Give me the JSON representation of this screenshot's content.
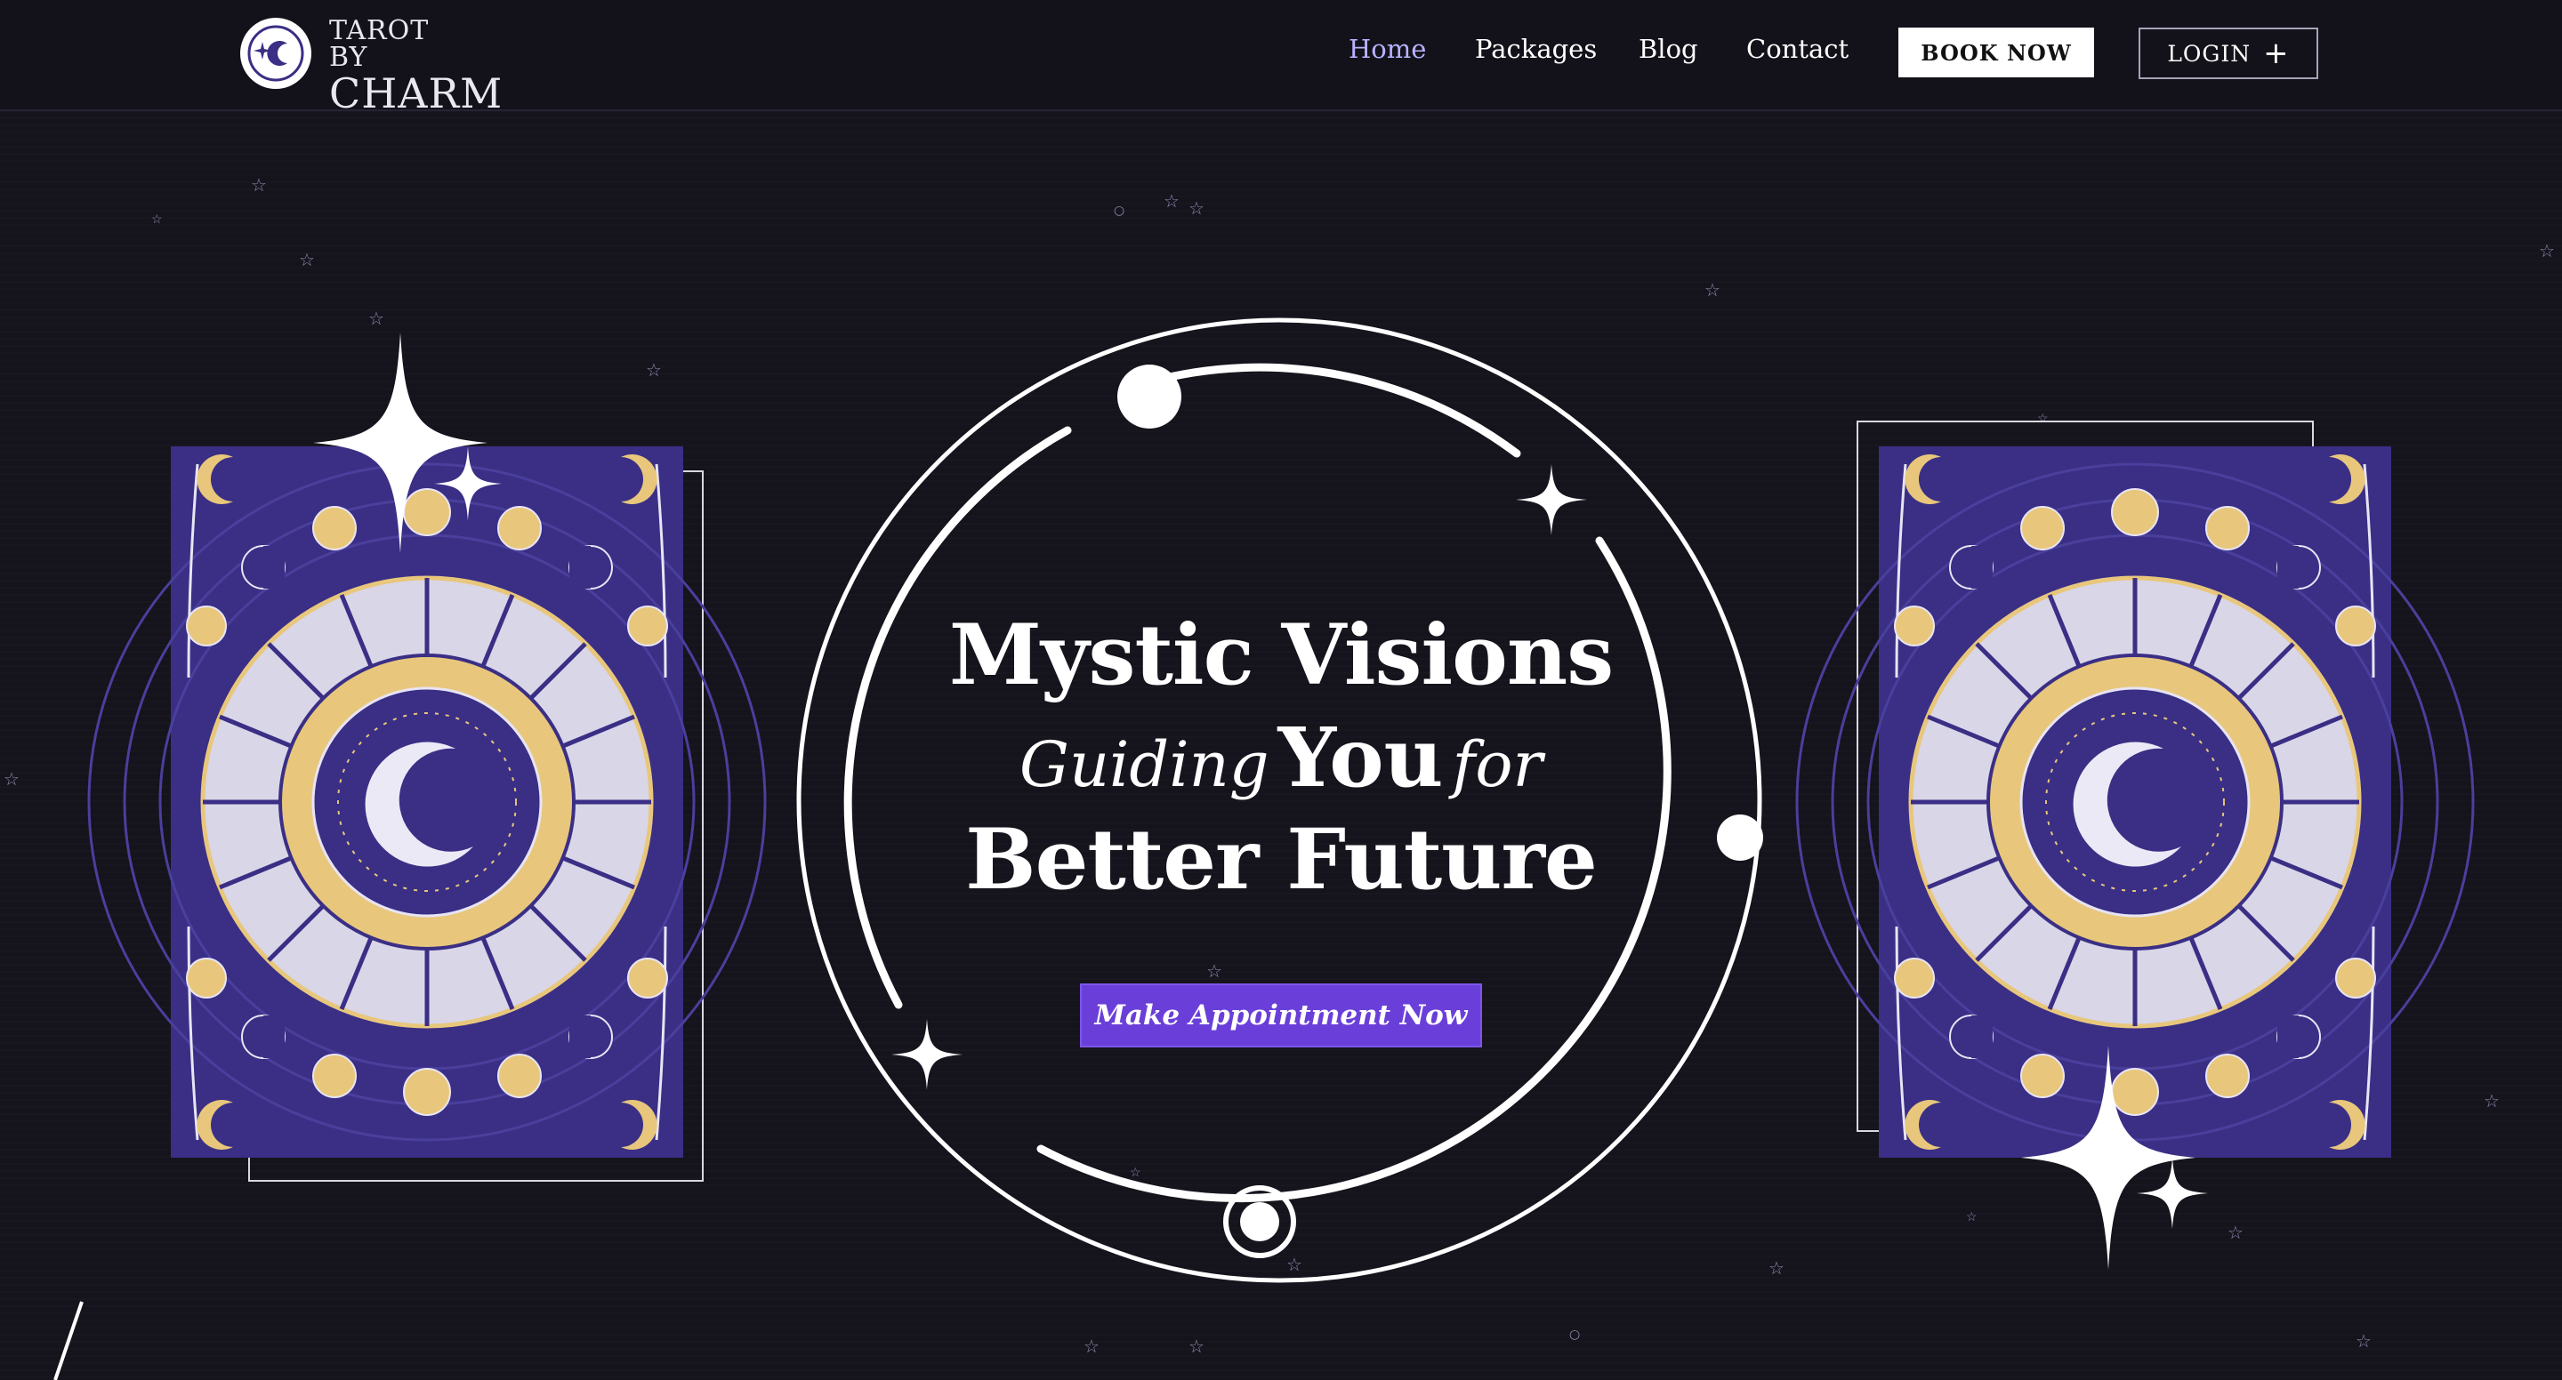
{
  "logo": {
    "line1": "TAROT BY",
    "line2": "CHARM"
  },
  "nav": {
    "items": [
      {
        "label": "Home",
        "active": true
      },
      {
        "label": "Packages",
        "active": false
      },
      {
        "label": "Blog",
        "active": false
      },
      {
        "label": "Contact",
        "active": false
      }
    ],
    "book_label": "BOOK NOW",
    "login_label": "LOGIN"
  },
  "hero": {
    "title": "Mystic Visions",
    "subtitle_part1": "Guiding",
    "subtitle_strong": "You",
    "subtitle_part2": "for",
    "title_line3": "Better Future",
    "cta_label": "Make Appointment Now"
  },
  "colors": {
    "background": "#15131c",
    "accent": "#6a3fd9",
    "card": "#3a2f85",
    "gold": "#e8c77c",
    "nav_active": "#b8b3ff"
  }
}
